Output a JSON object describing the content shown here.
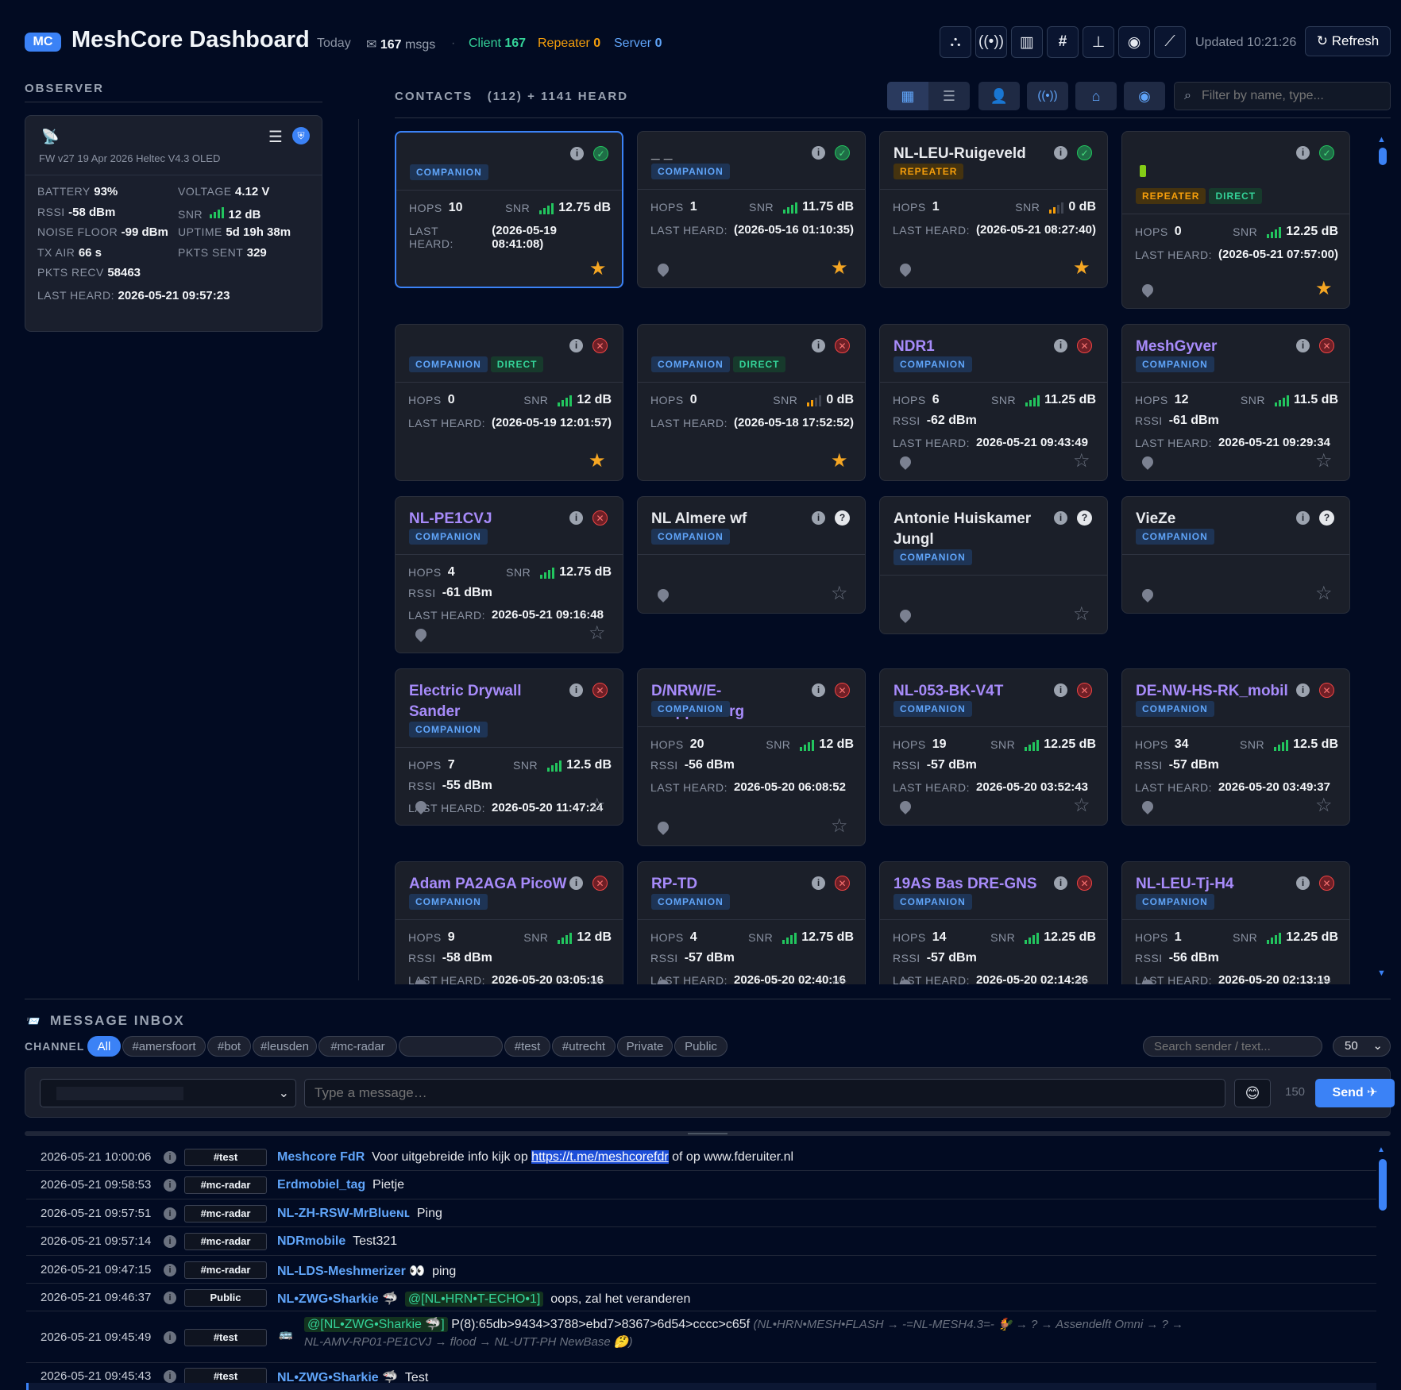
{
  "header": {
    "logo": "MC",
    "title": "MeshCore Dashboard",
    "period": "Today",
    "msgs_count": "167",
    "msgs_label": "msgs",
    "client_label": "Client",
    "client_count": "167",
    "repeater_label": "Repeater",
    "repeater_count": "0",
    "server_label": "Server",
    "server_count": "0",
    "updated": "Updated 10:21:26",
    "refresh": "↻ Refresh",
    "icons": [
      "nodes-icon",
      "antenna-icon",
      "bar-chart-icon",
      "hashtag-icon",
      "topology-icon",
      "satellite-icon",
      "line-chart-icon"
    ]
  },
  "observer": {
    "title": "OBSERVER",
    "firmware": "FW v27 19 Apr 2026 Heltec V4.3 OLED",
    "stats": [
      {
        "label": "BATTERY",
        "value": "93%"
      },
      {
        "label": "VOLTAGE",
        "value": "4.12 V"
      },
      {
        "label": "RSSI",
        "value": "-58 dBm"
      },
      {
        "label": "SNR",
        "value": "12 dB"
      },
      {
        "label": "NOISE FLOOR",
        "value": "-99 dBm"
      },
      {
        "label": "UPTIME",
        "value": "5d 19h 38m"
      },
      {
        "label": "TX AIR",
        "value": "66 s"
      },
      {
        "label": "PKTS SENT",
        "value": "329"
      },
      {
        "label": "PKTS RECV",
        "value": "58463"
      }
    ],
    "last_heard_label": "LAST HEARD:",
    "last_heard": "2026-05-21 09:57:23"
  },
  "contacts": {
    "title": "CONTACTS",
    "count": "(112) + 1141 HEARD",
    "filter_placeholder": "Filter by name, type...",
    "labels": {
      "hops": "HOPS",
      "snr": "SNR",
      "rssi": "RSSI",
      "last_heard": "LAST HEARD:"
    },
    "cards": [
      {
        "name": "",
        "badges": [
          "COMPANION"
        ],
        "status": "ok",
        "hops": "10",
        "snr": "12.75 dB",
        "rssi": "",
        "last": "(2026-05-19 08:41:08)",
        "fav": true,
        "pin": false
      },
      {
        "name": "_ _",
        "badges": [
          "COMPANION"
        ],
        "status": "ok",
        "hops": "1",
        "snr": "11.75 dB",
        "rssi": "",
        "last": "(2026-05-16 01:10:35)",
        "fav": true,
        "pin": true
      },
      {
        "name": "NL-LEU-Ruigeveld",
        "badges": [
          "REPEATER"
        ],
        "status": "ok",
        "hops": "1",
        "snr": "0 dB",
        "rssi": "",
        "last": "(2026-05-21 08:27:40)",
        "fav": true,
        "pin": true
      },
      {
        "name": "",
        "badges": [
          "REPEATER",
          "DIRECT"
        ],
        "status": "ok",
        "hops": "0",
        "snr": "12.25 dB",
        "rssi": "",
        "last": "(2026-05-21 07:57:00)",
        "fav": true,
        "pin": true
      },
      {
        "name": "",
        "badges": [
          "COMPANION",
          "DIRECT"
        ],
        "status": "no",
        "hops": "0",
        "snr": "12 dB",
        "rssi": "",
        "last": "(2026-05-19 12:01:57)",
        "fav": true,
        "pin": false
      },
      {
        "name": "",
        "badges": [
          "COMPANION",
          "DIRECT"
        ],
        "status": "no",
        "hops": "0",
        "snr": "0 dB",
        "rssi": "",
        "last": "(2026-05-18 17:52:52)",
        "fav": true,
        "pin": false
      },
      {
        "name": "NDR1",
        "badges": [
          "COMPANION"
        ],
        "status": "no",
        "hops": "6",
        "snr": "11.25 dB",
        "rssi": "-62 dBm",
        "last": "2026-05-21 09:43:49",
        "fav": false,
        "pin": true
      },
      {
        "name": "MeshGyver",
        "badges": [
          "COMPANION"
        ],
        "status": "no",
        "hops": "12",
        "snr": "11.5 dB",
        "rssi": "-61 dBm",
        "last": "2026-05-21 09:29:34",
        "fav": false,
        "pin": true
      },
      {
        "name": "NL-PE1CVJ",
        "badges": [
          "COMPANION"
        ],
        "status": "no",
        "hops": "4",
        "snr": "12.75 dB",
        "rssi": "-61 dBm",
        "last": "2026-05-21 09:16:48",
        "fav": false,
        "pin": true
      },
      {
        "name": "NL Almere wf",
        "badges": [
          "COMPANION"
        ],
        "status": "q",
        "fav": false,
        "pin": true
      },
      {
        "name": "Antonie Huiskamer Jungl",
        "badges": [
          "COMPANION"
        ],
        "status": "q",
        "fav": false,
        "pin": true
      },
      {
        "name": "VieZe",
        "badges": [
          "COMPANION"
        ],
        "status": "q",
        "fav": false,
        "pin": true
      },
      {
        "name": "Electric Drywall Sander",
        "badges": [
          "COMPANION"
        ],
        "status": "no",
        "hops": "7",
        "snr": "12.5 dB",
        "rssi": "-55 dBm",
        "last": "2026-05-20 11:47:24",
        "fav": false,
        "pin": true
      },
      {
        "name": "D/NRW/E-Stoppenberg",
        "badges": [
          "COMPANION"
        ],
        "status": "no",
        "hops": "20",
        "snr": "12 dB",
        "rssi": "-56 dBm",
        "last": "2026-05-20 06:08:52",
        "fav": false,
        "pin": true
      },
      {
        "name": "NL-053-BK-V4T",
        "badges": [
          "COMPANION"
        ],
        "status": "no",
        "hops": "19",
        "snr": "12.25 dB",
        "rssi": "-57 dBm",
        "last": "2026-05-20 03:52:43",
        "fav": false,
        "pin": true
      },
      {
        "name": "DE-NW-HS-RK_mobil",
        "badges": [
          "COMPANION"
        ],
        "status": "no",
        "hops": "34",
        "snr": "12.5 dB",
        "rssi": "-57 dBm",
        "last": "2026-05-20 03:49:37",
        "fav": false,
        "pin": true
      },
      {
        "name": "Adam PA2AGA PicoW",
        "badges": [
          "COMPANION"
        ],
        "status": "no",
        "hops": "9",
        "snr": "12 dB",
        "rssi": "-58 dBm",
        "last": "2026-05-20 03:05:16",
        "fav": false,
        "pin": true
      },
      {
        "name": "RP-TD",
        "badges": [
          "COMPANION"
        ],
        "status": "no",
        "hops": "4",
        "snr": "12.75 dB",
        "rssi": "-57 dBm",
        "last": "2026-05-20 02:40:16",
        "fav": false,
        "pin": true
      },
      {
        "name": "19AS Bas DRE-GNS",
        "badges": [
          "COMPANION"
        ],
        "status": "no",
        "hops": "14",
        "snr": "12.25 dB",
        "rssi": "-57 dBm",
        "last": "2026-05-20 02:14:26",
        "fav": false,
        "pin": true
      },
      {
        "name": "NL-LEU-Tj-H4",
        "badges": [
          "COMPANION"
        ],
        "status": "no",
        "hops": "1",
        "snr": "12.25 dB",
        "rssi": "-56 dBm",
        "last": "2026-05-20 02:13:19",
        "fav": false,
        "pin": true
      }
    ]
  },
  "inbox": {
    "title": "MESSAGE INBOX",
    "channel_label": "CHANNEL",
    "channels": [
      "All",
      "#amersfoort",
      "#bot",
      "#leusden",
      "#mc-radar",
      "",
      "#test",
      "#utrecht",
      "Private",
      "Public"
    ],
    "search_placeholder": "Search sender / text...",
    "limit": "50",
    "compose_placeholder": "Type a message…",
    "char_count": "150",
    "send": "Send ✈",
    "messages": [
      {
        "ts": "2026-05-21 10:00:06",
        "ch": "#test",
        "sender": "Meshcore FdR",
        "text": "Voor uitgebreide info kijk op",
        "link": "https://t.me/meshcorefdr",
        "text2": " of op www.fderuiter.nl"
      },
      {
        "ts": "2026-05-21 09:58:53",
        "ch": "#mc-radar",
        "sender": "Erdmobiel_tag",
        "text": "Pietje"
      },
      {
        "ts": "2026-05-21 09:57:51",
        "ch": "#mc-radar",
        "sender": "NL-ZH-RSW-MrBlueɴʟ",
        "text": "Ping"
      },
      {
        "ts": "2026-05-21 09:57:14",
        "ch": "#mc-radar",
        "sender": "NDRmobile",
        "text": "Test321"
      },
      {
        "ts": "2026-05-21 09:47:15",
        "ch": "#mc-radar",
        "sender": "NL-LDS-Meshmerizer 👀",
        "text": "ping"
      },
      {
        "ts": "2026-05-21 09:46:37",
        "ch": "Public",
        "sender": "NL•ZWG•Sharkie 🦈",
        "mention": "@[NL•HRN•T-ECHO•1]",
        "text": "oops, zal het veranderen"
      },
      {
        "ts": "2026-05-21 09:45:49",
        "ch": "#test",
        "sender": "",
        "mention": "@[NL•ZWG•Sharkie 🦈]",
        "text": "P(8):65db>9434>3788>ebd7>8367>6d54>cccc>c65f",
        "path": "(NL•HRN•MESH•FLASH → -=NL-MESH4.3=- 🐓 → ? → Assendelft Omni → ? →",
        "path2": "NL-AMV-RP01-PE1CVJ → flood → NL-UTT-PH NewBase 🤔)"
      },
      {
        "ts": "2026-05-21 09:45:43",
        "ch": "#test",
        "sender": "NL•ZWG•Sharkie 🦈",
        "text": "Test"
      }
    ]
  }
}
